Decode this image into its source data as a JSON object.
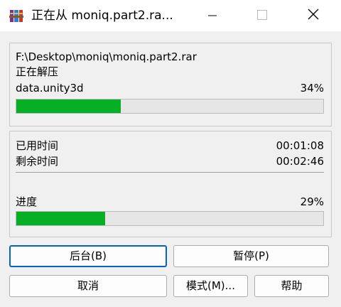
{
  "window": {
    "title": "正在从 moniq.part2.ra...",
    "icons": {
      "app": "winrar-books-icon",
      "minimize": "minimize-icon",
      "maximize": "maximize-icon",
      "close": "close-icon"
    }
  },
  "extraction": {
    "path": "F:\\Desktop\\moniq\\moniq.part2.rar",
    "status": "正在解压",
    "file_name": "data.unity3d",
    "file_percent_label": "34%",
    "file_progress": 0.34
  },
  "timing": {
    "elapsed_label": "已用时间",
    "elapsed_value": "00:01:08",
    "remaining_label": "剩余时间",
    "remaining_value": "00:02:46"
  },
  "overall": {
    "label": "进度",
    "percent_label": "29%",
    "progress": 0.29
  },
  "buttons": {
    "background": "后台(B)",
    "pause": "暂停(P)",
    "cancel": "取消",
    "mode": "模式(M)...",
    "help": "帮助"
  },
  "colors": {
    "progress_fill": "#06b025",
    "default_button_border": "#0067c0"
  }
}
